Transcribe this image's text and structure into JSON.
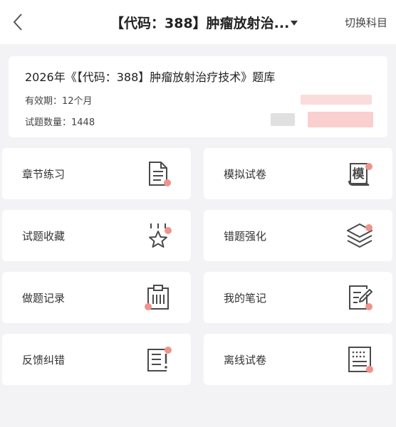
{
  "header": {
    "title": "【代码：388】肿瘤放射治...",
    "switch_label": "切换科目",
    "back_icon": "chevron-left-icon",
    "dropdown_icon": "caret-down-icon"
  },
  "info_card": {
    "title": "2026年《【代码：388】肿瘤放射治疗技术》题库",
    "validity": "有效期：12个月",
    "question_count": "试题数量：1448"
  },
  "colors": {
    "accent_dot": "#f0938b",
    "icon_stroke": "#4a4a4a",
    "background": "#f3f3f5",
    "card": "#ffffff"
  },
  "menu": {
    "items": [
      {
        "label": "章节练习",
        "icon": "document-icon"
      },
      {
        "label": "模拟试卷",
        "icon": "scroll-exam-icon"
      },
      {
        "label": "试题收藏",
        "icon": "star-icon"
      },
      {
        "label": "错题强化",
        "icon": "layers-icon"
      },
      {
        "label": "做题记录",
        "icon": "clipboard-icon"
      },
      {
        "label": "我的笔记",
        "icon": "note-edit-icon"
      },
      {
        "label": "反馈纠错",
        "icon": "feedback-icon"
      },
      {
        "label": "离线试卷",
        "icon": "offline-paper-icon"
      }
    ]
  }
}
